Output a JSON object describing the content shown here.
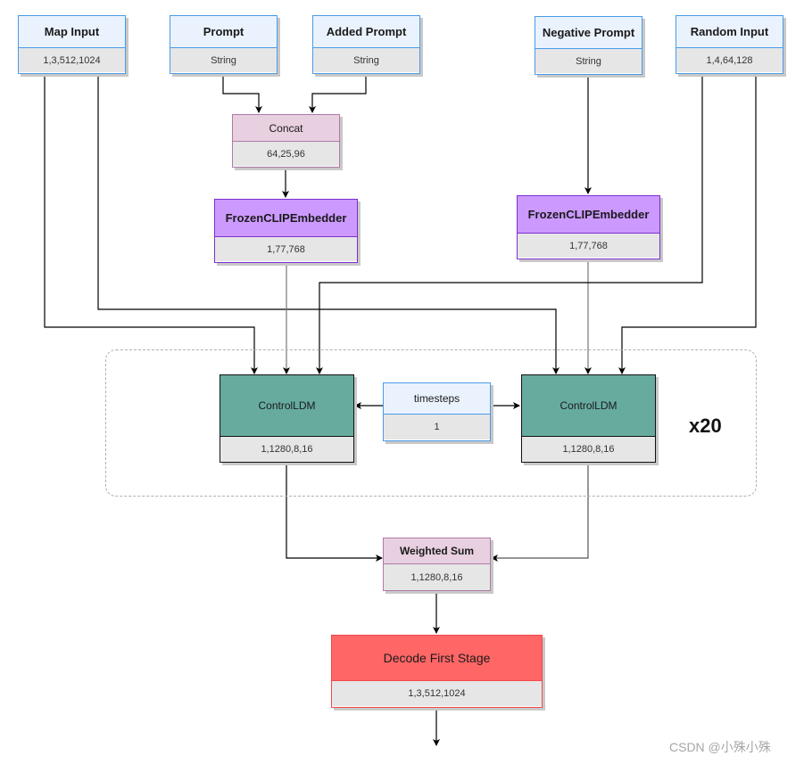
{
  "diagram": {
    "nodes": {
      "map_input": {
        "title": "Map Input",
        "shape": "1,3,512,1024"
      },
      "prompt": {
        "title": "Prompt",
        "shape": "String"
      },
      "added_prompt": {
        "title": "Added Prompt",
        "shape": "String"
      },
      "negative_prompt": {
        "title": "Negative Prompt",
        "shape": "String"
      },
      "random_input": {
        "title": "Random Input",
        "shape": "1,4,64,128"
      },
      "concat": {
        "title": "Concat",
        "shape": "64,25,96"
      },
      "clip_left": {
        "title": "FrozenCLIPEmbedder",
        "shape": "1,77,768"
      },
      "clip_right": {
        "title": "FrozenCLIPEmbedder",
        "shape": "1,77,768"
      },
      "controlldm_left": {
        "title": "ControlLDM",
        "shape": "1,1280,8,16"
      },
      "timesteps": {
        "title": "timesteps",
        "shape": "1"
      },
      "controlldm_right": {
        "title": "ControlLDM",
        "shape": "1,1280,8,16"
      },
      "weighted_sum": {
        "title": "Weighted Sum",
        "shape": "1,1280,8,16"
      },
      "decode_first_stage": {
        "title": "Decode First Stage",
        "shape": "1,3,512,1024"
      }
    },
    "loop": {
      "label": "x20"
    },
    "edges": [
      {
        "from": "prompt",
        "to": "concat"
      },
      {
        "from": "added_prompt",
        "to": "concat"
      },
      {
        "from": "concat",
        "to": "clip_left"
      },
      {
        "from": "negative_prompt",
        "to": "clip_right"
      },
      {
        "from": "map_input",
        "to": "controlldm_left"
      },
      {
        "from": "map_input",
        "to": "controlldm_right"
      },
      {
        "from": "clip_left",
        "to": "controlldm_left"
      },
      {
        "from": "clip_right",
        "to": "controlldm_right"
      },
      {
        "from": "random_input",
        "to": "controlldm_left"
      },
      {
        "from": "random_input",
        "to": "controlldm_right"
      },
      {
        "from": "timesteps",
        "to": "controlldm_left"
      },
      {
        "from": "timesteps",
        "to": "controlldm_right"
      },
      {
        "from": "controlldm_left",
        "to": "weighted_sum"
      },
      {
        "from": "controlldm_right",
        "to": "weighted_sum"
      },
      {
        "from": "weighted_sum",
        "to": "decode_first_stage"
      },
      {
        "from": "decode_first_stage",
        "to": "output"
      }
    ]
  },
  "watermark": "CSDN @小殊小殊"
}
